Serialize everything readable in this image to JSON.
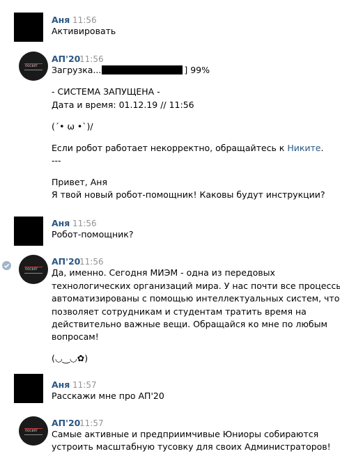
{
  "messages": [
    {
      "author": "Аня",
      "time": "11:56",
      "lines": [
        "Активировать"
      ]
    },
    {
      "author": "АП'20",
      "time": "11:56",
      "loading": {
        "label": "Загрузка...",
        "suffix": "] 99%",
        "progress": 0.99
      },
      "lines": [
        "",
        "- СИСТЕМА ЗАПУЩЕНА -",
        "Дата и время: 01.12.19 // 11:56",
        "",
        "(´• ω •`)/",
        "",
        "Если робот работает некорректно, обращайтесь к ",
        "---",
        "",
        "Привет, Аня",
        "Я твой новый робот-помощник! Каковы будут инструкции?"
      ],
      "link": "Никите",
      "link_after": "."
    },
    {
      "author": "Аня",
      "time": "11:56",
      "lines": [
        "Робот-помощник?"
      ]
    },
    {
      "author": "АП'20",
      "time": "11:56",
      "lines": [
        "Да, именно. Сегодня МИЭМ - одна из передовых",
        "технологических организаций мира. У нас почти все процессы",
        "автоматизированы с помощью интеллектуальных систем, что",
        "позволяет сотрудникам и студентам тратить время на",
        "действительно важные вещи. Обращайся ко мне по любым",
        "вопросам!",
        "",
        "(◡‿◡✿)"
      ]
    },
    {
      "author": "Аня",
      "time": "11:57",
      "lines": [
        "Расскажи мне про АП'20"
      ]
    },
    {
      "author": "АП'20",
      "time": "11:57",
      "lines": [
        "Самые активные и предприимчивые Юниоры собираются",
        "устроить масштабную тусовку для своих Администраторов!"
      ]
    }
  ],
  "avatar_logo_text": "ПОСВЯТ",
  "colors": {
    "author": "#2a5885",
    "time": "#939393",
    "link": "#2a5885",
    "read_badge": "#a3b5c9"
  }
}
